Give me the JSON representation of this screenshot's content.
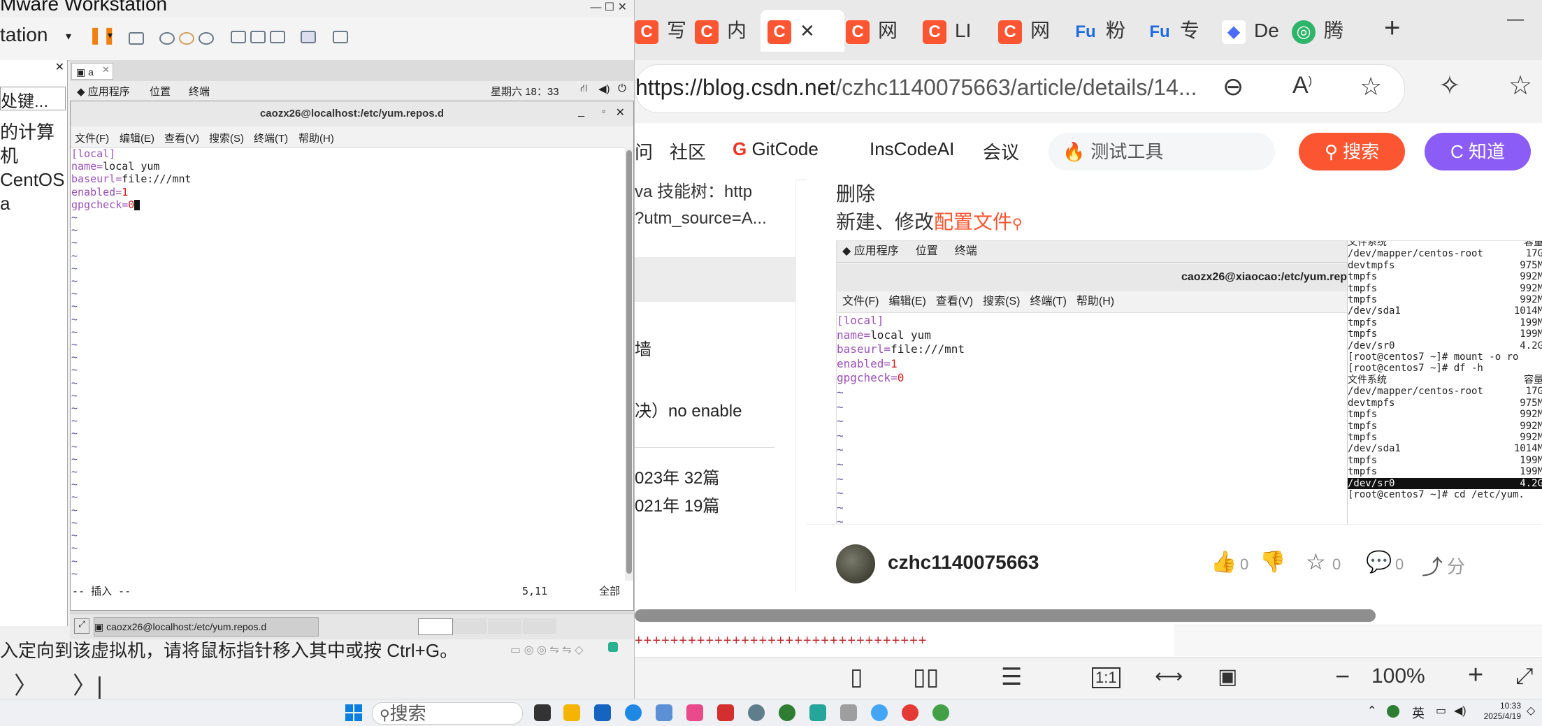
{
  "vmware": {
    "title": "Mware Workstation",
    "menu_label": "tation",
    "library_search_placeholder": "处键...",
    "library_lines": [
      "的计算机",
      "CentOS",
      "a"
    ],
    "vm_tab_label": "a",
    "gnome": {
      "apps": "应用程序",
      "places": "位置",
      "terminal": "终端",
      "clock": "星期六 18：33"
    },
    "terminal": {
      "title": "caozx26@localhost:/etc/yum.repos.d",
      "menus": [
        "文件(F)",
        "编辑(E)",
        "查看(V)",
        "搜索(S)",
        "终端(T)",
        "帮助(H)"
      ],
      "lines": [
        {
          "key": "[local]",
          "val": ""
        },
        {
          "key": "name=",
          "val": "local yum"
        },
        {
          "key": "baseurl=",
          "val": "file:///mnt"
        },
        {
          "key": "enabled=",
          "val": "1"
        },
        {
          "key": "gpgcheck=",
          "val": "0"
        }
      ],
      "tilde": "~",
      "mode": "-- 插入 --",
      "position": "5,11",
      "scope": "全部"
    },
    "vm_task_label": "caozx26@localhost:/etc/yum.repos.d",
    "status_text": "入定向到该虚拟机，请将鼠标指针移入其中或按 Ctrl+G。"
  },
  "browser": {
    "tabs": [
      "写",
      "内",
      "",
      "网",
      "LI",
      "网",
      "粉",
      "专",
      "De",
      "腾"
    ],
    "url_domain": "https://blog.csdn.net",
    "url_path": "/czhc1140075663/article/details/14...",
    "nav_links": [
      "问",
      "社区",
      "GitCode",
      "InsCodeAI",
      "会议"
    ],
    "search_placeholder": "测试工具",
    "search_button": "搜索",
    "zhidao_button": "C 知道",
    "left_col": [
      "va 技能树：http",
      "?utm_source=A...",
      "墙",
      "决）no enable",
      "023年  32篇",
      "021年  19篇"
    ],
    "article_heading_1": "删除",
    "article_heading_2_prefix": "新建、修改",
    "article_heading_2_link": "配置文件",
    "shot": {
      "apps": "应用程序",
      "places": "位置",
      "terminal": "终端",
      "title": "caozx26@xiaocao:/etc/yum.rep",
      "menus": [
        "文件(F)",
        "编辑(E)",
        "查看(V)",
        "搜索(S)",
        "终端(T)",
        "帮助(H)"
      ],
      "lines": [
        {
          "key": "[local]",
          "val": ""
        },
        {
          "key": "name=",
          "val": "local yum"
        },
        {
          "key": "baseurl=",
          "val": "file:///mnt"
        },
        {
          "key": "enabled=",
          "val": "1"
        },
        {
          "key": "gpgcheck=",
          "val": "0"
        }
      ],
      "df_lines": [
        [
          "文件系统",
          "容量"
        ],
        [
          "/dev/mapper/centos-root",
          "17G"
        ],
        [
          "devtmpfs",
          "975M"
        ],
        [
          "tmpfs",
          "992M"
        ],
        [
          "tmpfs",
          "992M"
        ],
        [
          "tmpfs",
          "992M"
        ],
        [
          "/dev/sda1",
          "1014M"
        ],
        [
          "tmpfs",
          "199M"
        ],
        [
          "tmpfs",
          "199M"
        ],
        [
          "/dev/sr0",
          "4.2G"
        ],
        [
          "[root@centos7 ~]# mount -o ro",
          ""
        ],
        [
          "[root@centos7 ~]# df -h",
          ""
        ],
        [
          "文件系统",
          "容量"
        ],
        [
          "/dev/mapper/centos-root",
          "17G"
        ],
        [
          "devtmpfs",
          "975M"
        ],
        [
          "tmpfs",
          "992M"
        ],
        [
          "tmpfs",
          "992M"
        ],
        [
          "tmpfs",
          "992M"
        ],
        [
          "/dev/sda1",
          "1014M"
        ],
        [
          "tmpfs",
          "199M"
        ],
        [
          "tmpfs",
          "199M"
        ],
        [
          "/dev/sr0",
          "4.2G"
        ],
        [
          "[root@centos7 ~]# cd /etc/yum.",
          ""
        ]
      ]
    },
    "author": "czhc1140075663",
    "like_count": "0",
    "fav_count": "0",
    "comment_count": "0",
    "share_label": "分",
    "red_line": "+++++++++++++++++++++++++++++++++",
    "zoom": "100%"
  },
  "taskbar": {
    "search": "搜索",
    "ime": "英",
    "time": "10:33",
    "date": "2025/4/19"
  },
  "colors": {
    "csdn_red": "#fc5531",
    "zhidao_purple": "#8b5cf6",
    "vim_purple": "#9b4fb8",
    "vim_red": "#d11d1d"
  }
}
